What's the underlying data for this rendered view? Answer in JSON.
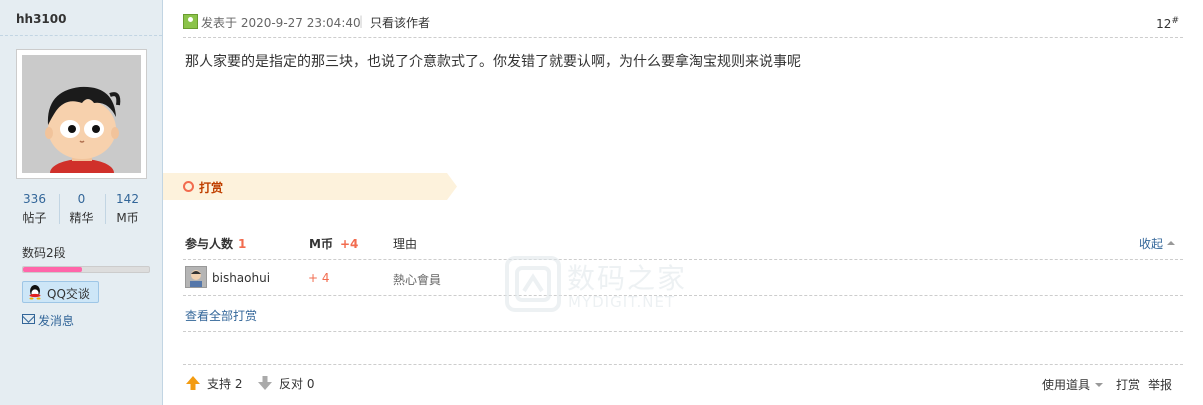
{
  "author": {
    "name": "hh3100",
    "stats": [
      {
        "value": "336",
        "label": "帖子"
      },
      {
        "value": "0",
        "label": "精华"
      },
      {
        "value": "142",
        "label": "M币"
      }
    ],
    "rank": "数码2段",
    "rank_progress": 0.47,
    "qq_label": "QQ交谈",
    "message_label": "发消息"
  },
  "post": {
    "posted_at": "发表于 2020-9-27 23:04:40",
    "divider": "|",
    "only_author": "只看该作者",
    "floor": "12",
    "floor_mark": "#",
    "content": "那人家要的是指定的那三块，也说了介意款式了。你发错了就要认啊，为什么要拿淘宝规则来说事呢"
  },
  "reward": {
    "title": "打赏",
    "header": {
      "participants_label": "参与人数",
      "participants_count": "1",
      "coin_label": "M币",
      "coin_total": "+4",
      "reason_label": "理由",
      "collapse_label": "收起"
    },
    "rows": [
      {
        "user": "bishaohui",
        "points": "+ 4",
        "reason": "熱心會員"
      }
    ],
    "view_all": "查看全部打赏"
  },
  "actions": {
    "support": "支持 2",
    "oppose": "反对 0",
    "tools": "使用道具",
    "tip": "打赏",
    "report": "举报"
  },
  "watermark": {
    "cn": "数码之家",
    "en": "MYDIGIT.NET"
  }
}
